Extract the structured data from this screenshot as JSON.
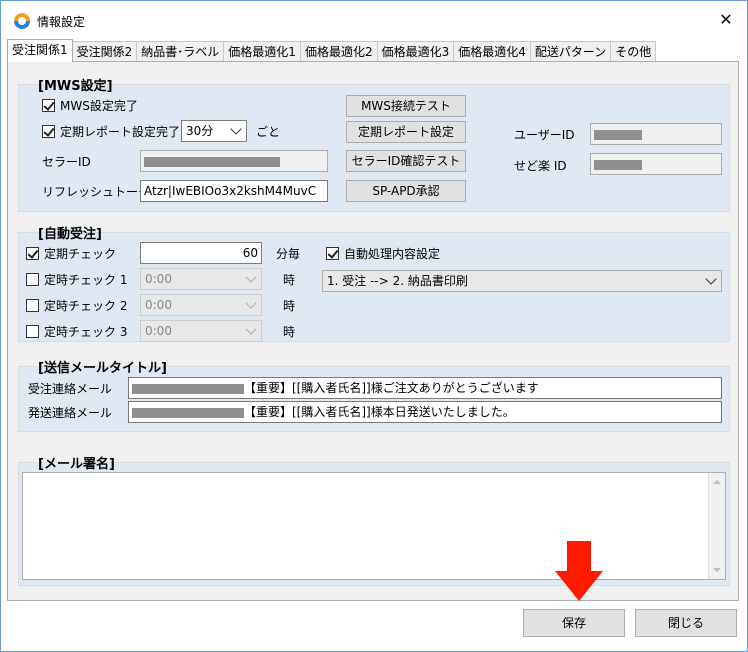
{
  "window": {
    "title": "情報設定",
    "close_glyph": "✕"
  },
  "tabs": [
    "受注関係1",
    "受注関係2",
    "納品書･ラベル",
    "価格最適化1",
    "価格最適化2",
    "価格最適化3",
    "価格最適化4",
    "配送パターン",
    "その他"
  ],
  "active_tab": 0,
  "mws": {
    "title": "[MWS設定]",
    "mws_done_label": "MWS設定完了",
    "mws_done_checked": true,
    "report_done_label": "定期レポート設定完了",
    "report_done_checked": true,
    "report_interval": "30分",
    "report_interval_suffix": "ごと",
    "seller_id_label": "セラーID",
    "refresh_token_label": "リフレッシュトークン",
    "refresh_token_value": "Atzr|IwEBIOo3x2kshM4MuvC",
    "btn_mws_test": "MWS接続テスト",
    "btn_report_setting": "定期レポート設定",
    "btn_seller_check": "セラーID確認テスト",
    "btn_spapi": "SP-APD承認",
    "user_id_label": "ユーザーID",
    "seduraku_id_label": "せど楽 ID"
  },
  "auto": {
    "title": "[自動受注]",
    "periodic_label": "定期チェック",
    "periodic_checked": true,
    "periodic_value": "60",
    "periodic_unit": "分毎",
    "fixed": [
      {
        "label": "定時チェック 1",
        "checked": false,
        "time": "0:00",
        "unit": "時"
      },
      {
        "label": "定時チェック 2",
        "checked": false,
        "time": "0:00",
        "unit": "時"
      },
      {
        "label": "定時チェック 3",
        "checked": false,
        "time": "0:00",
        "unit": "時"
      }
    ],
    "auto_process_label": "自動処理内容設定",
    "auto_process_checked": true,
    "auto_process_value": "1. 受注 --> 2. 納品書印刷"
  },
  "mail_title": {
    "title": "[送信メールタイトル]",
    "order_label": "受注連絡メール",
    "order_value": "【重要】[[購入者氏名]]様ご注文ありがとうございます",
    "ship_label": "発送連絡メール",
    "ship_value": "【重要】[[購入者氏名]]様本日発送いたしました。"
  },
  "signature": {
    "title": "[メール署名]"
  },
  "footer": {
    "save_label": "保存",
    "close_label": "閉じる"
  },
  "colors": {
    "group_bg": "#dfe8f3",
    "arrow": "#ff1a00",
    "panel_bg": "#f0f0f0"
  }
}
